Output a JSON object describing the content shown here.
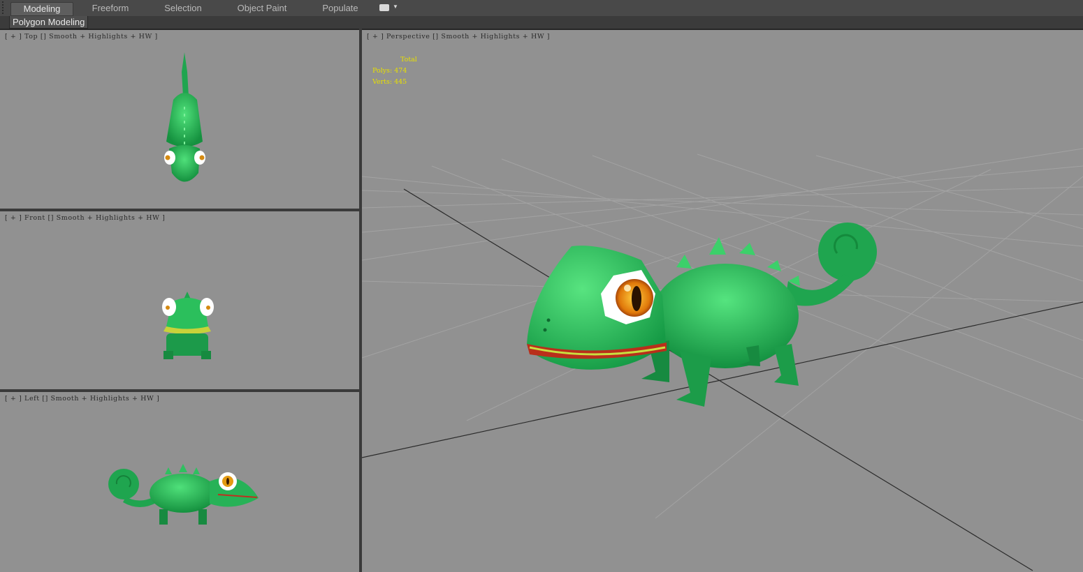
{
  "ribbon": {
    "tabs": [
      {
        "label": "Modeling",
        "active": true
      },
      {
        "label": "Freeform",
        "active": false
      },
      {
        "label": "Selection",
        "active": false
      },
      {
        "label": "Object Paint",
        "active": false
      },
      {
        "label": "Populate",
        "active": false
      }
    ],
    "toggle_icon": "ribbon-toggle-icon",
    "panel_label": "Polygon Modeling"
  },
  "viewports": {
    "top": {
      "label": "[ + ] Top [] Smooth + Highlights + HW ]"
    },
    "front": {
      "label": "[ + ] Front [] Smooth + Highlights + HW ]"
    },
    "left": {
      "label": "[ + ] Left [] Smooth + Highlights + HW ]"
    },
    "perspective": {
      "label": "[ + ] Perspective [] Smooth + Highlights + HW ]",
      "stats": {
        "header": "Total",
        "polys_label": "Polys:",
        "polys_value": "474",
        "verts_label": "Verts:",
        "verts_value": "445"
      }
    }
  },
  "colors": {
    "viewport_bg": "#919191",
    "model_green": "#1fa54f",
    "stats_yellow": "#e8e000"
  }
}
